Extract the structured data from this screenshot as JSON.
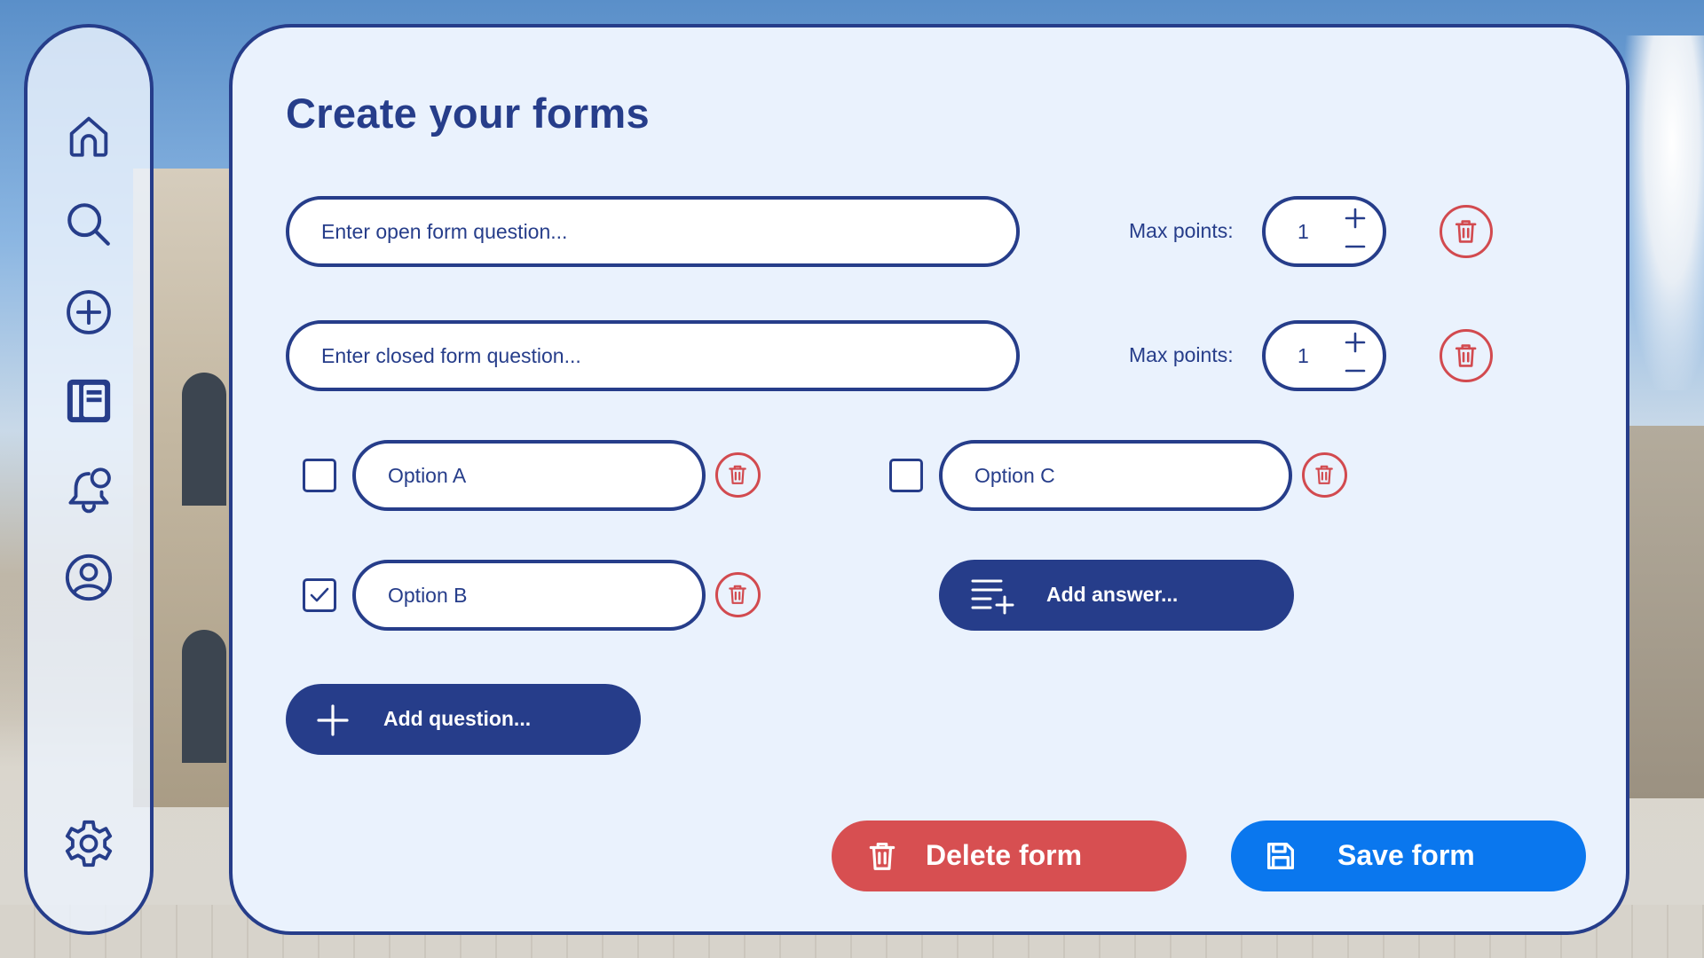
{
  "sidebar": {
    "items": [
      {
        "name": "home",
        "icon": "home-icon"
      },
      {
        "name": "search",
        "icon": "search-icon"
      },
      {
        "name": "create",
        "icon": "plus-circle-icon"
      },
      {
        "name": "forms",
        "icon": "notebook-icon",
        "active": true
      },
      {
        "name": "notifications",
        "icon": "bell-icon"
      },
      {
        "name": "profile",
        "icon": "user-circle-icon"
      },
      {
        "name": "settings",
        "icon": "gear-icon"
      }
    ]
  },
  "main": {
    "title": "Create your forms",
    "questions": [
      {
        "placeholder": "Enter open form question...",
        "points_label": "Max points:",
        "points": "1"
      },
      {
        "placeholder": "Enter closed form question...",
        "points_label": "Max points:",
        "points": "1"
      }
    ],
    "options": [
      {
        "label": "Option A",
        "checked": false
      },
      {
        "label": "Option B",
        "checked": true
      },
      {
        "label": "Option C",
        "checked": false
      }
    ],
    "add_answer_label": "Add answer...",
    "add_question_label": "Add question...",
    "delete_form_label": "Delete form",
    "save_form_label": "Save form"
  },
  "colors": {
    "navy": "#263d8a",
    "panel": "#eaf2fd",
    "danger": "#d74f51",
    "primary": "#0a77ee"
  }
}
